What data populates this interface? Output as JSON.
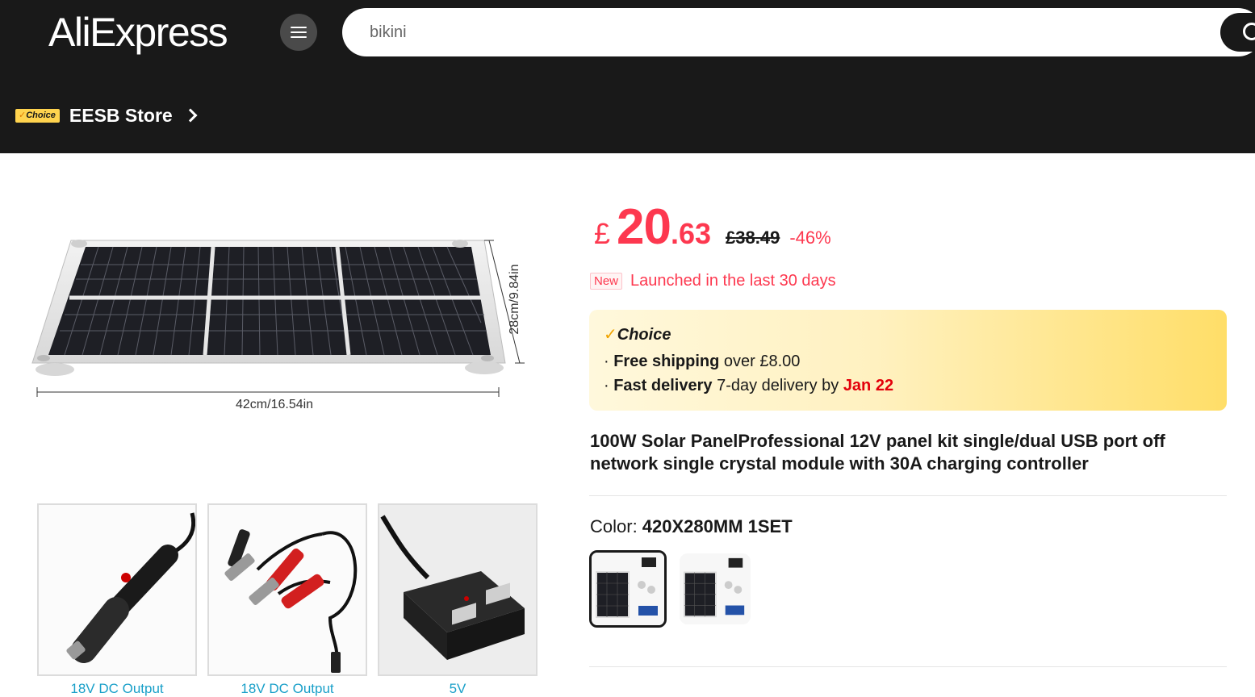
{
  "header": {
    "logo": "AliExpress",
    "search": {
      "value": "bikini",
      "placeholder": ""
    },
    "store": {
      "badge": "Choice",
      "name": "EESB Store"
    }
  },
  "gallery": {
    "main_image": {
      "width_label": "42cm/16.54in",
      "height_label": "28cm/9.84in"
    },
    "thumbnails": [
      {
        "caption": "18V DC Output"
      },
      {
        "caption": "18V DC Output"
      },
      {
        "caption": "5V"
      }
    ]
  },
  "price": {
    "currency": "£",
    "integer": "20",
    "decimal": ".63",
    "original": "£38.49",
    "discount": "-46%"
  },
  "launch": {
    "tag": "New",
    "text": "Launched in the last 30 days"
  },
  "choice_box": {
    "title": "Choice",
    "shipping_bold": "Free shipping",
    "shipping_rest": " over ",
    "shipping_amount": "£8.00",
    "delivery_bold": "Fast delivery",
    "delivery_rest": " 7-day delivery by ",
    "delivery_date": "Jan 22"
  },
  "product": {
    "title": "100W Solar PanelProfessional 12V panel kit single/dual USB port off network single crystal module with 30A charging controller",
    "color_label": "Color: ",
    "color_value": "420X280MM 1SET"
  },
  "colors": {
    "accent_red": "#fd384f",
    "header_bg": "#191919",
    "choice_yellow": "#ffd34e",
    "caption_blue": "#1aa0c9"
  }
}
